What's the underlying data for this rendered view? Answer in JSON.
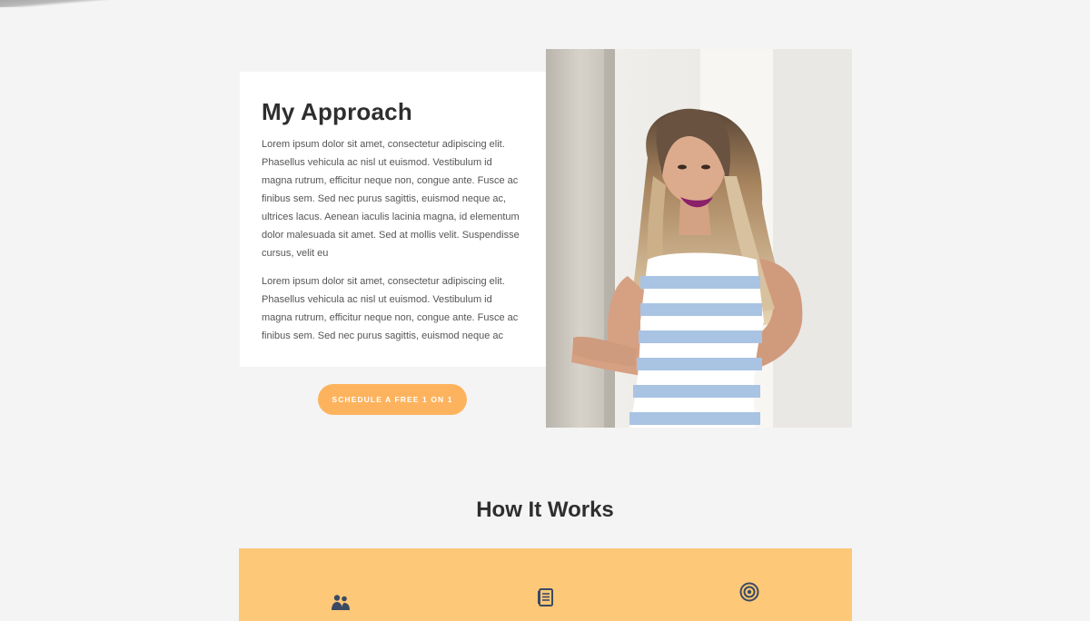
{
  "approach": {
    "title": "My Approach",
    "paragraphs": [
      "Lorem ipsum dolor sit amet, consectetur adipiscing elit. Phasellus vehicula ac nisl ut euismod. Vestibulum id magna rutrum, efficitur neque non, congue ante. Fusce ac finibus sem. Sed nec purus sagittis, euismod neque ac, ultrices lacus. Aenean iaculis lacinia magna, id elementum dolor malesuada sit amet. Sed at mollis velit. Suspendisse cursus, velit eu",
      "Lorem ipsum dolor sit amet, consectetur adipiscing elit. Phasellus vehicula ac nisl ut euismod. Vestibulum id magna rutrum, efficitur neque non, congue ante. Fusce ac finibus sem. Sed nec purus sagittis, euismod neque ac"
    ],
    "cta_label": "SCHEDULE A FREE 1 ON 1"
  },
  "how_it_works": {
    "title": "How It Works",
    "icons": [
      "people-icon",
      "document-icon",
      "target-icon"
    ]
  },
  "colors": {
    "accent": "#fdb35d",
    "band": "#fdc878",
    "icon": "#3b4a63",
    "background": "#f4f4f4"
  }
}
